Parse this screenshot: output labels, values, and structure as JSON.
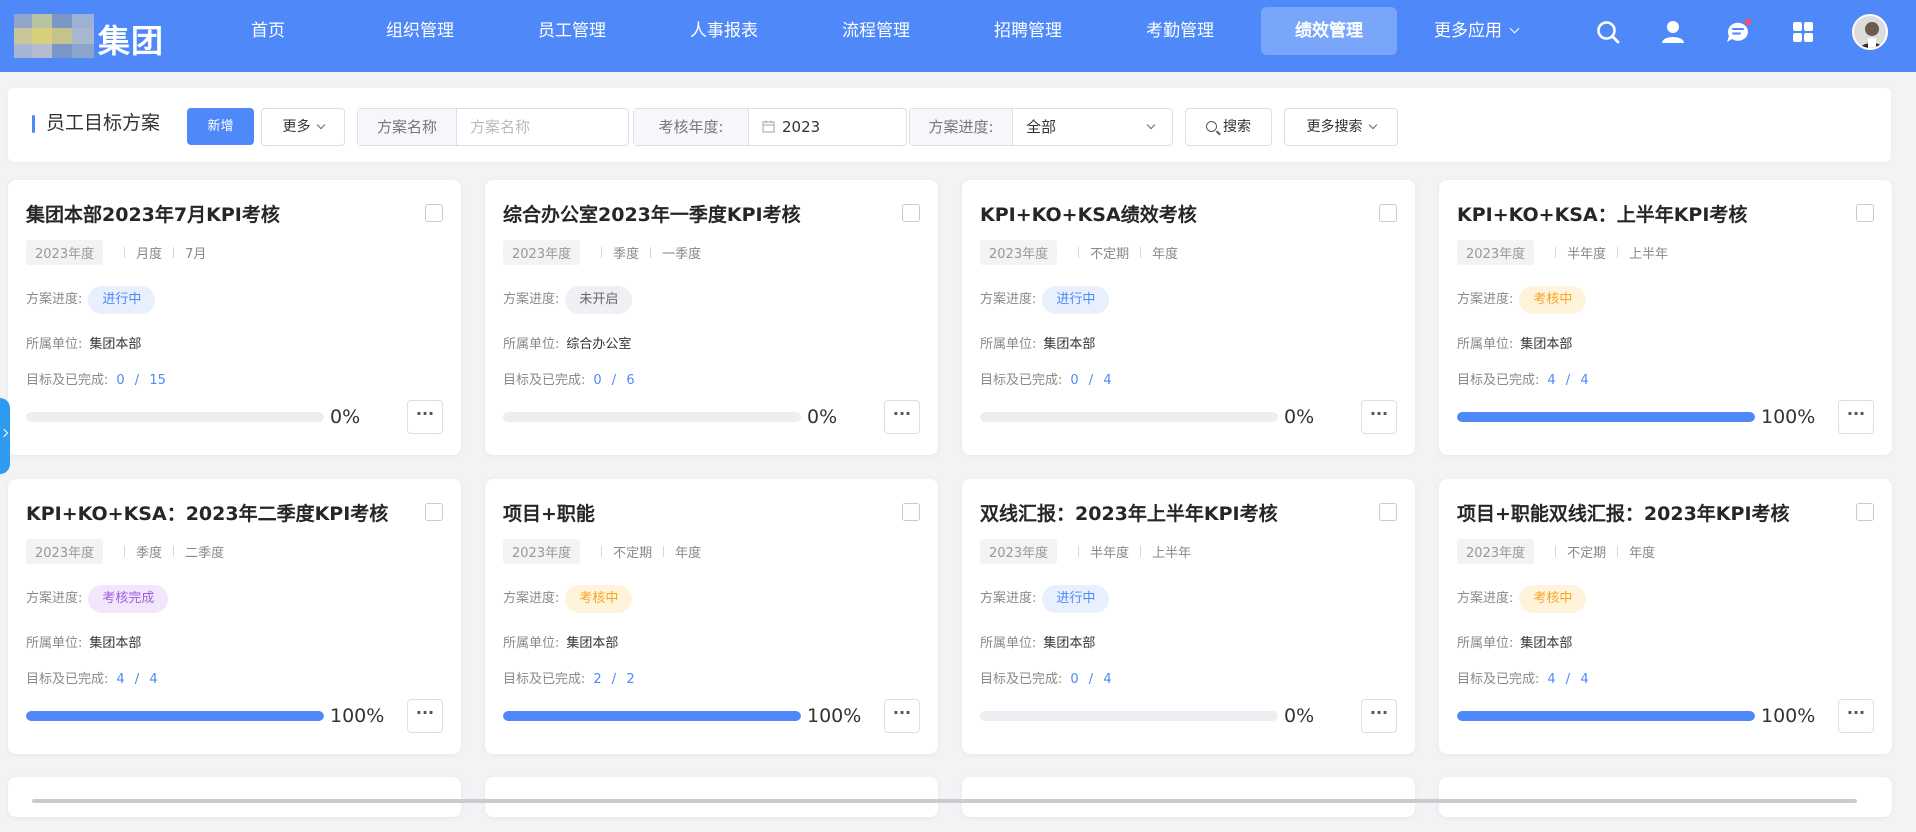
{
  "brand": {
    "logo_text": "集团"
  },
  "nav": {
    "items": [
      "首页",
      "组织管理",
      "员工管理",
      "人事报表",
      "流程管理",
      "招聘管理",
      "考勤管理",
      "绩效管理"
    ],
    "active": "绩效管理",
    "more_label": "更多应用",
    "icons": [
      "search-icon",
      "user-icon",
      "message-icon",
      "apps-grid-icon"
    ],
    "accent_color": "#4e88f9"
  },
  "toolbar": {
    "page_title": "员工目标方案",
    "add_label": "新增",
    "more_label": "更多",
    "plan_name_label": "方案名称",
    "plan_name_placeholder": "方案名称",
    "year_label": "考核年度:",
    "year_value": "2023",
    "progress_label": "方案进度:",
    "progress_value": "全部",
    "search_label": "搜索",
    "advanced_search_label": "更多搜索"
  },
  "labels": {
    "status": "方案进度:",
    "unit": "所属单位:",
    "goals": "目标及已完成:"
  },
  "cards": [
    {
      "title": "集团本部2023年7月KPI考核",
      "year": "2023年度",
      "period_type": "月度",
      "period": "7月",
      "status": "进行中",
      "status_color": "blue",
      "unit": "集团本部",
      "goals_done": "0",
      "goals_total": "15",
      "progress_text": "0%",
      "progress": 0
    },
    {
      "title": "综合办公室2023年一季度KPI考核",
      "year": "2023年度",
      "period_type": "季度",
      "period": "一季度",
      "status": "未开启",
      "status_color": "gray",
      "unit": "综合办公室",
      "goals_done": "0",
      "goals_total": "6",
      "progress_text": "0%",
      "progress": 0
    },
    {
      "title": "KPI+KO+KSA绩效考核",
      "year": "2023年度",
      "period_type": "不定期",
      "period": "年度",
      "status": "进行中",
      "status_color": "blue",
      "unit": "集团本部",
      "goals_done": "0",
      "goals_total": "4",
      "progress_text": "0%",
      "progress": 0
    },
    {
      "title": "KPI+KO+KSA：上半年KPI考核",
      "year": "2023年度",
      "period_type": "半年度",
      "period": "上半年",
      "status": "考核中",
      "status_color": "orange",
      "unit": "集团本部",
      "goals_done": "4",
      "goals_total": "4",
      "progress_text": "100%",
      "progress": 100
    },
    {
      "title": "KPI+KO+KSA：2023年二季度KPI考核",
      "year": "2023年度",
      "period_type": "季度",
      "period": "二季度",
      "status": "考核完成",
      "status_color": "purple",
      "unit": "集团本部",
      "goals_done": "4",
      "goals_total": "4",
      "progress_text": "100%",
      "progress": 100
    },
    {
      "title": "项目+职能",
      "year": "2023年度",
      "period_type": "不定期",
      "period": "年度",
      "status": "考核中",
      "status_color": "orange",
      "unit": "集团本部",
      "goals_done": "2",
      "goals_total": "2",
      "progress_text": "100%",
      "progress": 100
    },
    {
      "title": "双线汇报：2023年上半年KPI考核",
      "year": "2023年度",
      "period_type": "半年度",
      "period": "上半年",
      "status": "进行中",
      "status_color": "blue",
      "unit": "集团本部",
      "goals_done": "0",
      "goals_total": "4",
      "progress_text": "0%",
      "progress": 0
    },
    {
      "title": "项目+职能双线汇报：2023年KPI考核",
      "year": "2023年度",
      "period_type": "不定期",
      "period": "年度",
      "status": "考核中",
      "status_color": "orange",
      "unit": "集团本部",
      "goals_done": "4",
      "goals_total": "4",
      "progress_text": "100%",
      "progress": 100
    }
  ],
  "status_colors": {
    "blue": {
      "bg": "#e8f0fe",
      "fg": "#4e88f9"
    },
    "gray": {
      "bg": "#eef0f3",
      "fg": "#666666"
    },
    "orange": {
      "bg": "#fff3dc",
      "fg": "#f5a623"
    },
    "purple": {
      "bg": "#f1e6fb",
      "fg": "#a15ddb"
    }
  }
}
